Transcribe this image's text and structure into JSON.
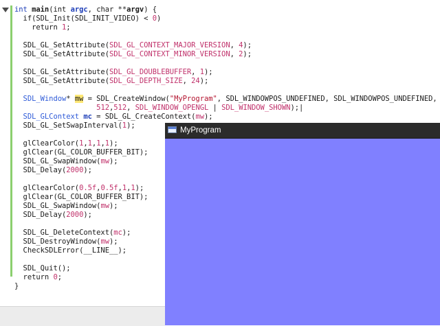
{
  "editor": {
    "lines": [
      [
        {
          "t": "int",
          "c": "kw"
        },
        {
          "t": " "
        },
        {
          "t": "main",
          "c": "bold"
        },
        {
          "t": "(int "
        },
        {
          "t": "argc",
          "c": "kwb"
        },
        {
          "t": ", char **"
        },
        {
          "t": "argv",
          "c": "bold"
        },
        {
          "t": ") {"
        }
      ],
      [
        {
          "t": "  if(SDL_Init(SDL_INIT_VIDEO) < "
        },
        {
          "t": "0",
          "c": "num"
        },
        {
          "t": ")"
        }
      ],
      [
        {
          "t": "    return "
        },
        {
          "t": "1",
          "c": "num"
        },
        {
          "t": ";"
        }
      ],
      [],
      [
        {
          "t": "  SDL_GL_SetAttribute("
        },
        {
          "t": "SDL_GL_CONTEXT_MAJOR_VERSION",
          "c": "mac"
        },
        {
          "t": ", "
        },
        {
          "t": "4",
          "c": "num"
        },
        {
          "t": ");"
        }
      ],
      [
        {
          "t": "  SDL_GL_SetAttribute("
        },
        {
          "t": "SDL_GL_CONTEXT_MINOR_VERSION",
          "c": "mac"
        },
        {
          "t": ", "
        },
        {
          "t": "2",
          "c": "num"
        },
        {
          "t": ");"
        }
      ],
      [],
      [
        {
          "t": "  SDL_GL_SetAttribute("
        },
        {
          "t": "SDL_GL_DOUBLEBUFFER",
          "c": "mac"
        },
        {
          "t": ", "
        },
        {
          "t": "1",
          "c": "num"
        },
        {
          "t": ");"
        }
      ],
      [
        {
          "t": "  SDL_GL_SetAttribute("
        },
        {
          "t": "SDL_GL_DEPTH_SIZE",
          "c": "mac"
        },
        {
          "t": ", "
        },
        {
          "t": "24",
          "c": "num"
        },
        {
          "t": ");"
        }
      ],
      [],
      [
        {
          "t": "  "
        },
        {
          "t": "SDL_Window",
          "c": "typ"
        },
        {
          "t": "* "
        },
        {
          "t": "mw",
          "c": "hl"
        },
        {
          "t": " = SDL_CreateWindow("
        },
        {
          "t": "\"MyProgram\"",
          "c": "str"
        },
        {
          "t": ", SDL_WINDOWPOS_UNDEFINED, SDL_WINDOWPOS_UNDEFINED,"
        }
      ],
      [
        {
          "t": "                   "
        },
        {
          "t": "512",
          "c": "num"
        },
        {
          "t": ","
        },
        {
          "t": "512",
          "c": "num"
        },
        {
          "t": ", "
        },
        {
          "t": "SDL_WINDOW_OPENGL",
          "c": "mac"
        },
        {
          "t": " | "
        },
        {
          "t": "SDL_WINDOW_SHOWN",
          "c": "mac"
        },
        {
          "t": ");|"
        }
      ],
      [
        {
          "t": "  "
        },
        {
          "t": "SDL_GLContext",
          "c": "typ"
        },
        {
          "t": " "
        },
        {
          "t": "mc",
          "c": "kwb"
        },
        {
          "t": " = SDL_GL_CreateContext("
        },
        {
          "t": "mw",
          "c": "num"
        },
        {
          "t": ");"
        }
      ],
      [
        {
          "t": "  SDL_GL_SetSwapInterval("
        },
        {
          "t": "1",
          "c": "num"
        },
        {
          "t": ");"
        }
      ],
      [],
      [
        {
          "t": "  glClearColor("
        },
        {
          "t": "1",
          "c": "num"
        },
        {
          "t": ","
        },
        {
          "t": "1",
          "c": "num"
        },
        {
          "t": ","
        },
        {
          "t": "1",
          "c": "num"
        },
        {
          "t": ","
        },
        {
          "t": "1",
          "c": "num"
        },
        {
          "t": ");"
        }
      ],
      [
        {
          "t": "  glClear(GL_COLOR_BUFFER_BIT);"
        }
      ],
      [
        {
          "t": "  SDL_GL_SwapWindow("
        },
        {
          "t": "mw",
          "c": "num"
        },
        {
          "t": ");"
        }
      ],
      [
        {
          "t": "  SDL_Delay("
        },
        {
          "t": "2000",
          "c": "num"
        },
        {
          "t": ");"
        }
      ],
      [],
      [
        {
          "t": "  glClearColor("
        },
        {
          "t": "0.5f",
          "c": "num"
        },
        {
          "t": ","
        },
        {
          "t": "0.5f",
          "c": "num"
        },
        {
          "t": ","
        },
        {
          "t": "1",
          "c": "num"
        },
        {
          "t": ","
        },
        {
          "t": "1",
          "c": "num"
        },
        {
          "t": ");"
        }
      ],
      [
        {
          "t": "  glClear(GL_COLOR_BUFFER_BIT);"
        }
      ],
      [
        {
          "t": "  SDL_GL_SwapWindow("
        },
        {
          "t": "mw",
          "c": "num"
        },
        {
          "t": ");"
        }
      ],
      [
        {
          "t": "  SDL_Delay("
        },
        {
          "t": "2000",
          "c": "num"
        },
        {
          "t": ");"
        }
      ],
      [],
      [
        {
          "t": "  SDL_GL_DeleteContext("
        },
        {
          "t": "mc",
          "c": "num"
        },
        {
          "t": ");"
        }
      ],
      [
        {
          "t": "  SDL_DestroyWindow("
        },
        {
          "t": "mw",
          "c": "num"
        },
        {
          "t": ");"
        }
      ],
      [
        {
          "t": "  CheckSDLError(__LINE__);"
        }
      ],
      [],
      [
        {
          "t": "  SDL_Quit();"
        }
      ],
      [
        {
          "t": "  return "
        },
        {
          "t": "0",
          "c": "num"
        },
        {
          "t": ";"
        }
      ],
      [
        {
          "t": "}"
        }
      ]
    ]
  },
  "program_window": {
    "title": "MyProgram",
    "icon": "window-app-icon",
    "clear_color": "#8080ff"
  }
}
